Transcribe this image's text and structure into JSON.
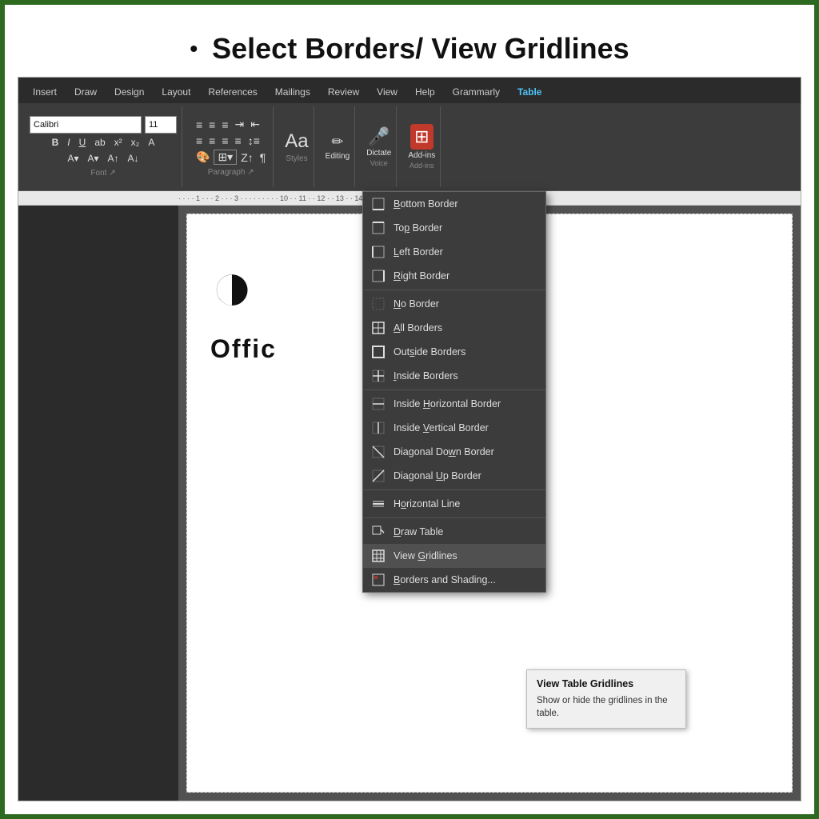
{
  "page": {
    "border_color": "#2d6a1f",
    "title": "Select Borders/ View Gridlines"
  },
  "ribbon": {
    "tabs": [
      "Insert",
      "Draw",
      "Design",
      "Layout",
      "References",
      "Mailings",
      "Review",
      "View",
      "Help",
      "Grammarly",
      "Table"
    ],
    "active_tab": "Table",
    "font": "Calibri",
    "size": "11",
    "groups": {
      "styles_label": "Styles",
      "editing_label": "Editing",
      "dictate_label": "Dictate",
      "addins_label": "Add-ins",
      "voice_label": "Voice"
    }
  },
  "dropdown": {
    "items": [
      {
        "id": "bottom-border",
        "label": "Bottom Border",
        "icon": "⊟",
        "underline_char": "B"
      },
      {
        "id": "top-border",
        "label": "Top Border",
        "icon": "⊞",
        "underline_char": "T"
      },
      {
        "id": "left-border",
        "label": "Left Border",
        "icon": "⊡",
        "underline_char": "L"
      },
      {
        "id": "right-border",
        "label": "Right Border",
        "icon": "⊡",
        "underline_char": "R"
      },
      {
        "id": "divider1",
        "type": "divider"
      },
      {
        "id": "no-border",
        "label": "No Border",
        "icon": "▣",
        "underline_char": "N"
      },
      {
        "id": "all-borders",
        "label": "All Borders",
        "icon": "⊞",
        "underline_char": "A"
      },
      {
        "id": "outside-borders",
        "label": "Outside Borders",
        "icon": "□",
        "underline_char": "s"
      },
      {
        "id": "inside-borders",
        "label": "Inside Borders",
        "icon": "⊕",
        "underline_char": "I"
      },
      {
        "id": "divider2",
        "type": "divider"
      },
      {
        "id": "inside-horiz",
        "label": "Inside Horizontal Border",
        "icon": "⊟",
        "underline_char": "H"
      },
      {
        "id": "inside-vert",
        "label": "Inside Vertical Border",
        "icon": "⊞",
        "underline_char": "V"
      },
      {
        "id": "diag-down",
        "label": "Diagonal Down Border",
        "icon": "◪",
        "underline_char": "w"
      },
      {
        "id": "diag-up",
        "label": "Diagonal Up Border",
        "icon": "◩",
        "underline_char": "U"
      },
      {
        "id": "divider3",
        "type": "divider"
      },
      {
        "id": "horiz-line",
        "label": "Horizontal Line",
        "icon": "≡",
        "underline_char": "o"
      },
      {
        "id": "divider4",
        "type": "divider"
      },
      {
        "id": "draw-table",
        "label": "Draw Table",
        "icon": "✏",
        "underline_char": "D"
      },
      {
        "id": "view-gridlines",
        "label": "View Gridlines",
        "icon": "⊞",
        "underline_char": "G",
        "selected": true
      },
      {
        "id": "borders-shading",
        "label": "Borders and Shading...",
        "icon": "▣",
        "underline_char": "B"
      }
    ]
  },
  "tooltip": {
    "title": "View Table Gridlines",
    "description": "Show or hide the gridlines in the table."
  },
  "doc": {
    "text": "Offic"
  }
}
